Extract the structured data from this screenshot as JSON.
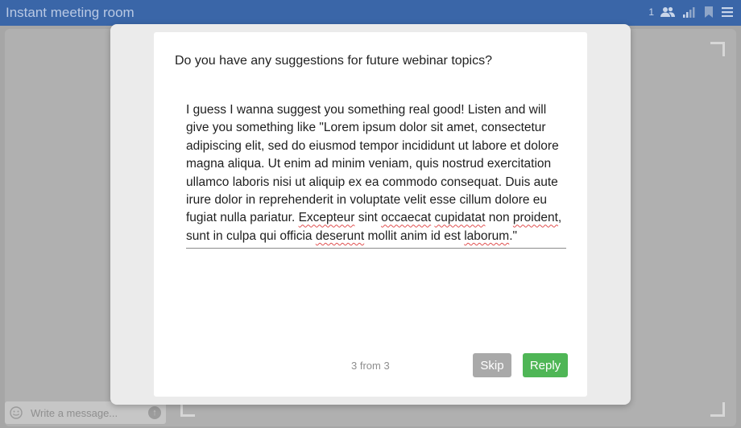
{
  "topbar": {
    "title": "Instant meeting room",
    "participant_count": "1",
    "icons": [
      "users-icon",
      "signal-icon",
      "bookmark-icon",
      "menu-icon"
    ],
    "color": "#3a66a8"
  },
  "chat": {
    "placeholder": "Write a message...",
    "icons": [
      "smile-icon",
      "send-icon"
    ]
  },
  "poll": {
    "question": "Do you have any suggestions for future webinar topics?",
    "answer_segments": [
      "I guess I wanna suggest you something real good! Listen and will give you something like \"Lorem ipsum dolor sit amet, consectetur adipiscing elit, sed do eiusmod tempor incididunt ut labore et dolore magna aliqua. Ut enim ad minim veniam, quis nostrud exercitation ullamco laboris nisi ut aliquip ex ea commodo consequat. Duis aute irure dolor in reprehenderit in voluptate velit esse cillum dolore eu fugiat nulla pariatur. ",
      "Excepteur",
      " sint ",
      "occaecat",
      " ",
      "cupidatat",
      " non ",
      "proident",
      ", sunt in culpa qui officia ",
      "deserunt",
      " mollit anim id est ",
      "laborum",
      ".\""
    ],
    "progress": "3 from 3",
    "skip_label": "Skip",
    "reply_label": "Reply",
    "reply_color": "#4fb656",
    "skip_color": "#a9a9a9"
  }
}
